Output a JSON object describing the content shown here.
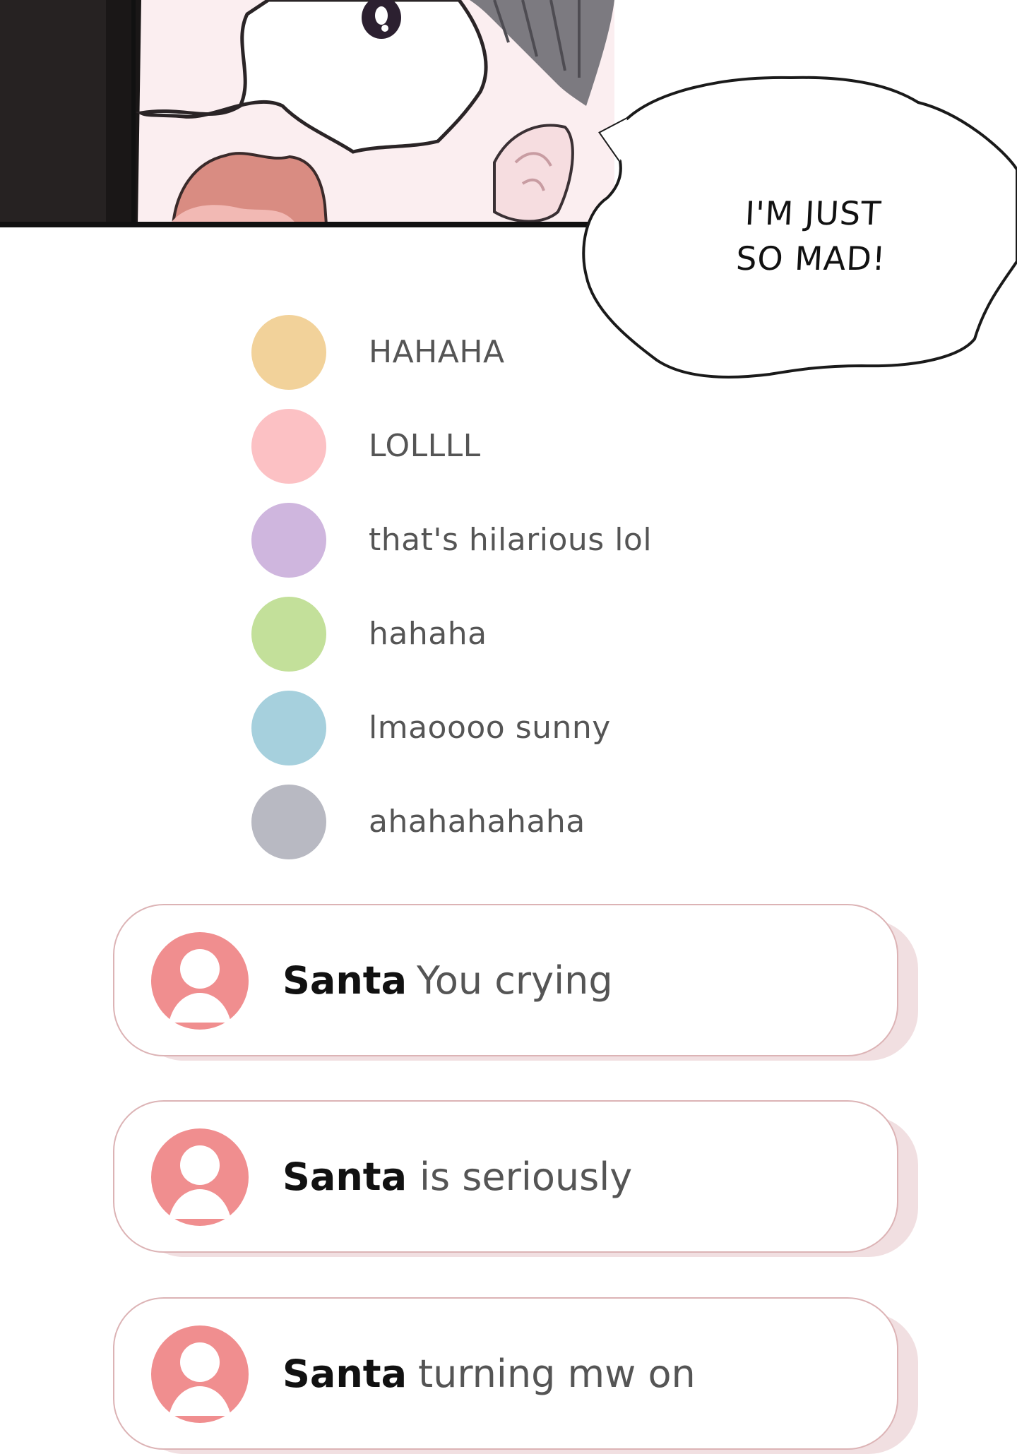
{
  "bubble": {
    "line1": "I'M JUST",
    "line2": "SO MAD!"
  },
  "reactions": [
    {
      "text": "HAHAHA",
      "color": "#f2d29a"
    },
    {
      "text": "LOLLLL",
      "color": "#fcc1c4"
    },
    {
      "text": "that's hilarious lol",
      "color": "#cfb6de"
    },
    {
      "text": "hahaha",
      "color": "#c3e09a"
    },
    {
      "text": "lmaoooo sunny",
      "color": "#a6d0dd"
    },
    {
      "text": "ahahahahaha",
      "color": "#b8b9c2"
    }
  ],
  "comments": [
    {
      "user": "Santa",
      "message": "You crying"
    },
    {
      "user": "Santa",
      "message": "is seriously"
    },
    {
      "user": "Santa",
      "message": "turning mw on"
    }
  ],
  "colors": {
    "avatar": "#f08e8f",
    "card_border": "#dcb3b5",
    "card_shadow": "#f1dfe1"
  }
}
